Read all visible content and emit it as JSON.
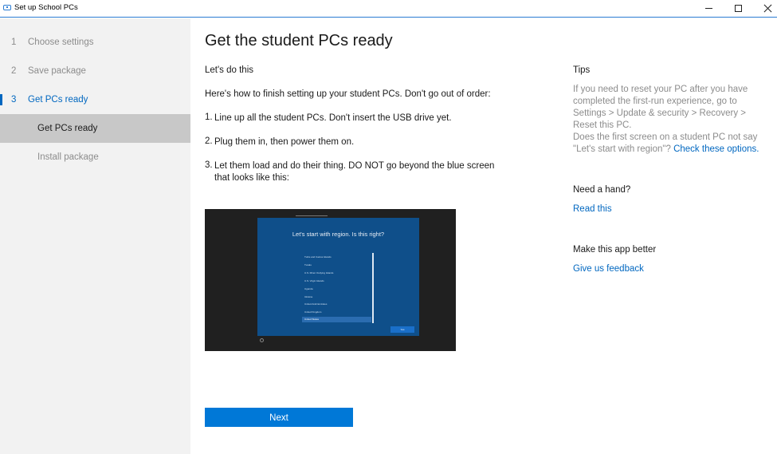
{
  "window": {
    "title": "Set up School PCs",
    "controls": [
      "minimize-icon",
      "maximize-icon",
      "close-icon"
    ]
  },
  "sidebar": {
    "steps": [
      {
        "num": "1",
        "label": "Choose settings"
      },
      {
        "num": "2",
        "label": "Save package"
      },
      {
        "num": "3",
        "label": "Get PCs ready"
      }
    ],
    "substeps": [
      {
        "label": "Get PCs ready"
      },
      {
        "label": "Install package"
      }
    ],
    "active_step": "3",
    "accent": "#0067c0"
  },
  "main": {
    "title": "Get the student PCs ready",
    "intro": "Let's do this",
    "instructions": "Here's how to finish setting up your student PCs. Don't go out of order:",
    "list": [
      {
        "num": "1.",
        "text": "Line up all the student PCs. Don't insert the USB drive yet."
      },
      {
        "num": "2.",
        "text": "Plug them in, then power them on."
      },
      {
        "num": "3.",
        "text": "Let them load and do their thing. DO NOT go beyond the blue screen that looks like this:"
      }
    ],
    "preview": {
      "heading": "Let's start with region. Is this right?",
      "items": [
        "Turks and Caicos Islands",
        "Tuvalu",
        "U.S. Minor Outlying Islands",
        "U.S. Virgin Islands",
        "Uganda",
        "Ukraine",
        "United Arab Emirates",
        "United Kingdom",
        "United States"
      ],
      "selected": "United States",
      "yes_label": "Yes"
    },
    "next_label": "Next"
  },
  "tips": {
    "heading": "Tips",
    "body": "If you need to reset your PC after you have completed the first-run experience, go to Settings > Update & security > Recovery > Reset this PC.",
    "question": "Does the first screen on a student PC not say \"Let's start with region\"?",
    "link": "Check these options."
  },
  "help": {
    "heading": "Need a hand?",
    "link": "Read this"
  },
  "feedback": {
    "heading": "Make this app better",
    "link": "Give us feedback"
  }
}
